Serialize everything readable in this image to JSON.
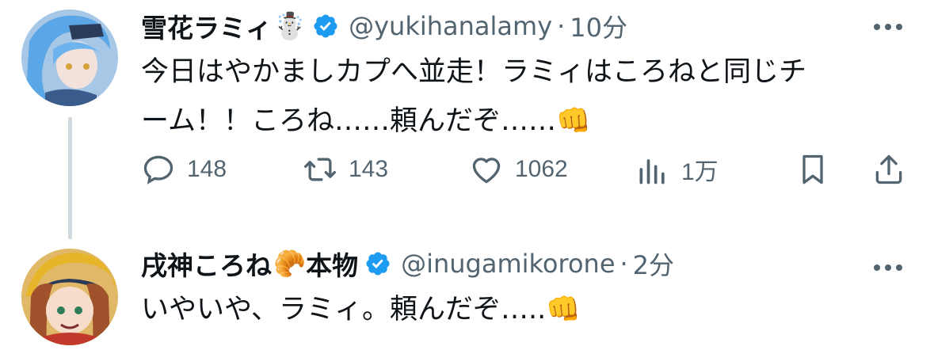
{
  "tweets": [
    {
      "display_name": "雪花ラミィ",
      "name_emoji": "☃️",
      "handle": "@yukihanalamy",
      "separator": "·",
      "time": "10分",
      "text_lines": [
        "今日はやかましカプへ並走！ラミィはころねと同じチ",
        "ーム！！ころね……頼んだぞ……👊"
      ],
      "actions": {
        "reply_count": "148",
        "retweet_count": "143",
        "like_count": "1062",
        "views_count": "1万"
      }
    },
    {
      "display_name": "戌神ころね",
      "name_emoji": "🥐",
      "name_suffix": "本物",
      "handle": "@inugamikorone",
      "separator": "·",
      "time": "2分",
      "text_lines": [
        "いやいや、ラミィ。頼んだぞ…..👊"
      ]
    }
  ],
  "colors": {
    "verified": "#1d9bf0",
    "secondary_text": "#536471",
    "primary_text": "#0f1419",
    "thread_line": "#cfd9de"
  },
  "icons": [
    "more-icon",
    "verified-icon",
    "reply-icon",
    "retweet-icon",
    "like-icon",
    "views-icon",
    "bookmark-icon",
    "share-icon"
  ]
}
